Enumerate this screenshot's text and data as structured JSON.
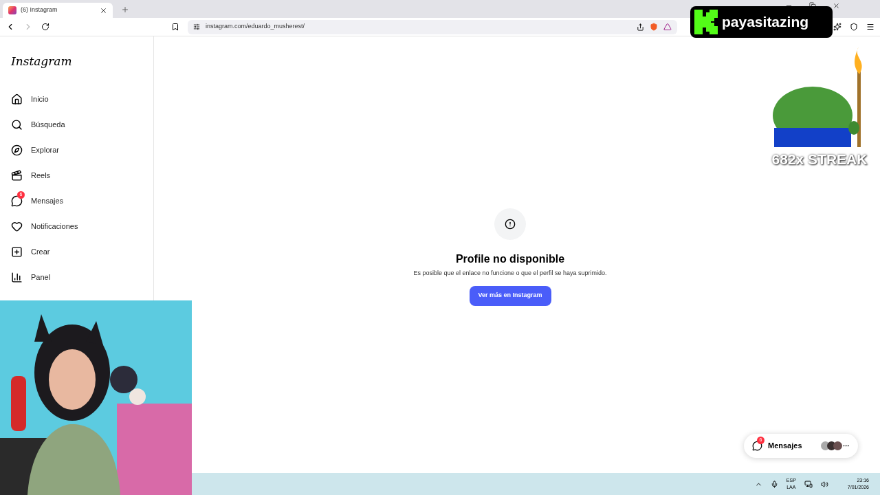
{
  "browser": {
    "tab": {
      "title": "(6) Instagram",
      "selected": true
    },
    "url": "instagram.com/eduardo_musherest/"
  },
  "sidebar": {
    "logo": "Instagram",
    "items": [
      {
        "kind": "home",
        "label": "Inicio"
      },
      {
        "kind": "search",
        "label": "Búsqueda"
      },
      {
        "kind": "explore",
        "label": "Explorar"
      },
      {
        "kind": "reels",
        "label": "Reels"
      },
      {
        "kind": "messages",
        "label": "Mensajes",
        "badge": "6"
      },
      {
        "kind": "heart",
        "label": "Notificaciones"
      },
      {
        "kind": "create",
        "label": "Crear"
      },
      {
        "kind": "panel",
        "label": "Panel"
      }
    ]
  },
  "main": {
    "title": "Profile no disponible",
    "message": "Es posible que el enlace no funcione o que el perfil se haya suprimido.",
    "button": "Ver más en Instagram"
  },
  "messages_pill": {
    "label": "Mensajes",
    "badge": "6"
  },
  "overlay": {
    "channel": "payasitazing",
    "streak": "682x STREAK"
  },
  "taskbar": {
    "lang_1": "ESP",
    "lang_2": "LAA",
    "time": "23:16",
    "date": "7/01/2026"
  }
}
